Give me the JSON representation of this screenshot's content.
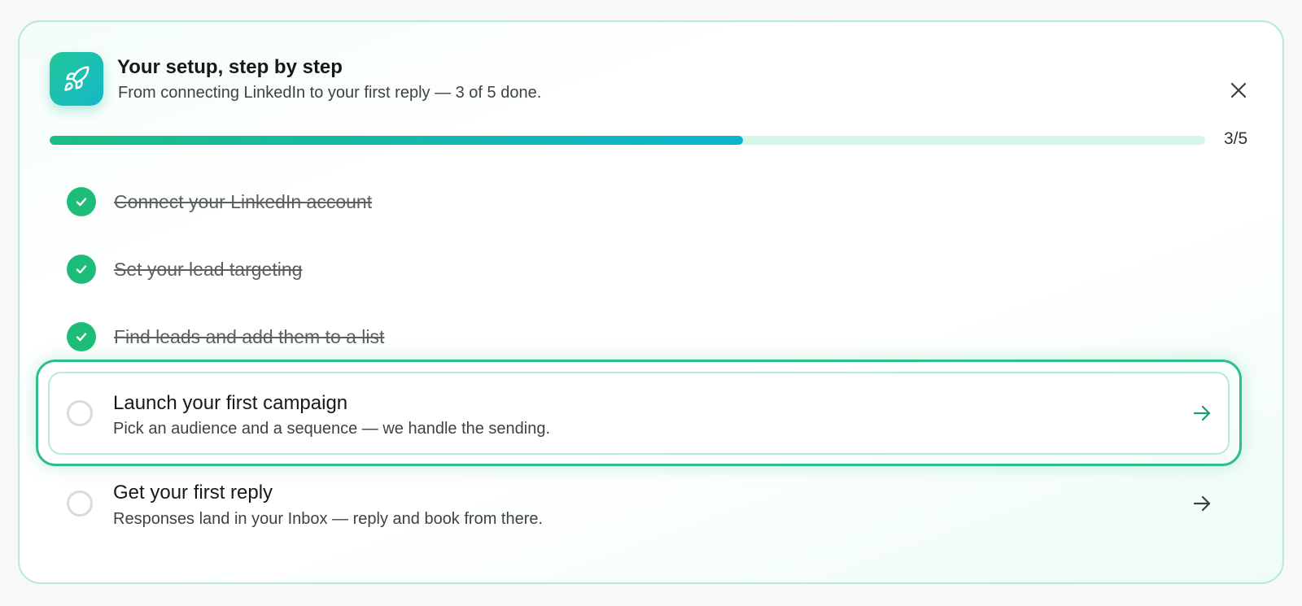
{
  "header": {
    "icon": "rocket-icon",
    "title": "Your setup, step by step",
    "subtitle": "From connecting LinkedIn to your first reply — 3 of 5 done.",
    "close_icon": "close-icon"
  },
  "progress": {
    "completed": 3,
    "total": 5,
    "fraction": 0.6,
    "label": "3/5"
  },
  "steps": [
    {
      "title": "Connect your LinkedIn account",
      "status": "done"
    },
    {
      "title": "Set your lead targeting",
      "status": "done"
    },
    {
      "title": "Find leads and add them to a list",
      "status": "done"
    },
    {
      "title": "Launch your first campaign",
      "description": "Pick an audience and a sequence — we handle the sending.",
      "status": "active"
    },
    {
      "title": "Get your first reply",
      "description": "Responses land in your Inbox — reply and book from there.",
      "status": "todo"
    }
  ],
  "colors": {
    "accent_green": "#1dbd79",
    "accent_teal": "#0db3cf",
    "active_border": "#2fbf86",
    "track": "#d6f7e7"
  }
}
